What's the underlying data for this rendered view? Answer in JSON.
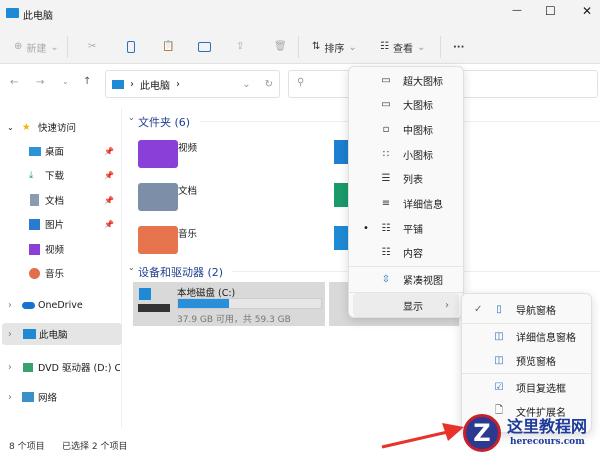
{
  "window": {
    "title": "此电脑",
    "minimize": "—",
    "maximize": "☐",
    "close": "✕"
  },
  "toolbar": {
    "new": "新建",
    "sort": "排序",
    "view": "查看",
    "more": "···"
  },
  "address": {
    "path": "此电脑",
    "sep": "›"
  },
  "sidebar": {
    "items": [
      {
        "label": "快速访问",
        "icon": "star-icon"
      },
      {
        "label": "桌面",
        "icon": "desktop-icon",
        "pinned": true
      },
      {
        "label": "下载",
        "icon": "download-icon",
        "pinned": true
      },
      {
        "label": "文档",
        "icon": "document-icon",
        "pinned": true
      },
      {
        "label": "图片",
        "icon": "picture-icon",
        "pinned": true
      },
      {
        "label": "视频",
        "icon": "video-icon"
      },
      {
        "label": "音乐",
        "icon": "music-icon"
      },
      {
        "label": "OneDrive",
        "icon": "cloud-icon"
      },
      {
        "label": "此电脑",
        "icon": "computer-icon"
      },
      {
        "label": "DVD 驱动器 (D:) CI",
        "icon": "dvd-icon"
      },
      {
        "label": "网络",
        "icon": "network-icon"
      }
    ]
  },
  "content": {
    "folders_header": "文件夹 (6)",
    "folders": [
      "视频",
      "文档",
      "音乐"
    ],
    "devices_header": "设备和驱动器 (2)",
    "drive": {
      "name": "本地磁盘 (C:)",
      "free": "37.9 GB 可用，共 59.3 GB",
      "used_fraction": 0.36
    }
  },
  "view_menu": {
    "items": [
      "超大图标",
      "大图标",
      "中图标",
      "小图标",
      "列表",
      "详细信息",
      "平铺",
      "内容"
    ],
    "compact": "紧凑视图",
    "show": "显示"
  },
  "show_menu": {
    "items": [
      "导航窗格",
      "详细信息窗格",
      "预览窗格",
      "项目复选框",
      "文件扩展名"
    ]
  },
  "status": {
    "count": "8 个项目",
    "selected": "已选择 2 个项目"
  },
  "watermark": {
    "name": "这里教程网",
    "url": "herecours.com"
  }
}
